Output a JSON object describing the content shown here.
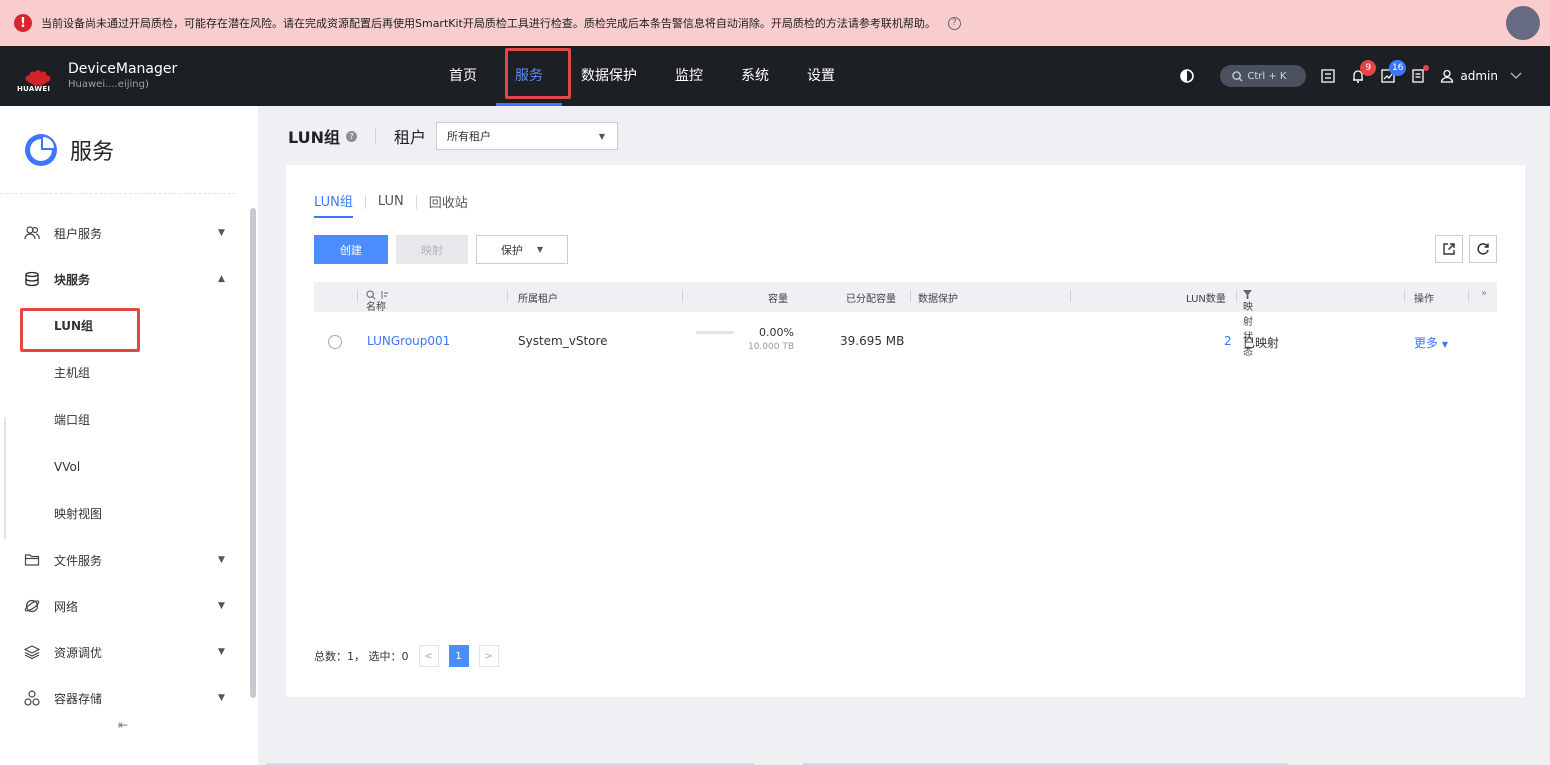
{
  "alert": {
    "message": "当前设备尚未通过开局质检，可能存在潜在风险。请在完成资源配置后再使用SmartKit开局质检工具进行检查。质检完成后本条告警信息将自动消除。开局质检的方法请参考联机帮助。"
  },
  "brand": {
    "logo_text": "HUAWEI",
    "app_name": "DeviceManager",
    "device_name": "Huawei....eijing)"
  },
  "nav": {
    "items": [
      "首页",
      "服务",
      "数据保护",
      "监控",
      "系统",
      "设置"
    ],
    "active_index": 1
  },
  "toolbar": {
    "search_shortcut": "Ctrl + K",
    "alarm_count": "9",
    "task_count": "16",
    "user": "admin"
  },
  "sidebar": {
    "title": "服务",
    "groups": [
      {
        "label": "租户服务",
        "icon": "tenant-icon",
        "expanded": false
      },
      {
        "label": "块服务",
        "icon": "block-storage-icon",
        "expanded": true,
        "children": [
          "LUN组",
          "主机组",
          "端口组",
          "VVol",
          "映射视图"
        ],
        "active_child": 0
      },
      {
        "label": "文件服务",
        "icon": "folder-icon",
        "expanded": false
      },
      {
        "label": "网络",
        "icon": "network-icon",
        "expanded": false
      },
      {
        "label": "资源调优",
        "icon": "layers-icon",
        "expanded": false
      },
      {
        "label": "容器存储",
        "icon": "container-icon",
        "expanded": false
      }
    ]
  },
  "page": {
    "title": "LUN组",
    "tenant_label": "租户",
    "tenant_value": "所有租户",
    "tabs": [
      "LUN组",
      "LUN",
      "回收站"
    ],
    "active_tab": 0,
    "buttons": {
      "create": "创建",
      "map": "映射",
      "protect": "保护"
    }
  },
  "table": {
    "headers": {
      "name": "名称",
      "tenant": "所属租户",
      "capacity": "容量",
      "allocated": "已分配容量",
      "protection": "数据保护",
      "lun_count": "LUN数量",
      "mapping": "映射状态",
      "operation": "操作"
    },
    "rows": [
      {
        "name": "LUNGroup001",
        "tenant": "System_vStore",
        "capacity_pct": "0.00%",
        "capacity_total": "10.000 TB",
        "usage_fraction": 0.0,
        "allocated": "39.695 MB",
        "protection": "",
        "lun_count": "2",
        "mapping": "已映射",
        "more": "更多"
      }
    ]
  },
  "pager": {
    "summary": "总数：1， 选中：0",
    "current_page": "1"
  }
}
